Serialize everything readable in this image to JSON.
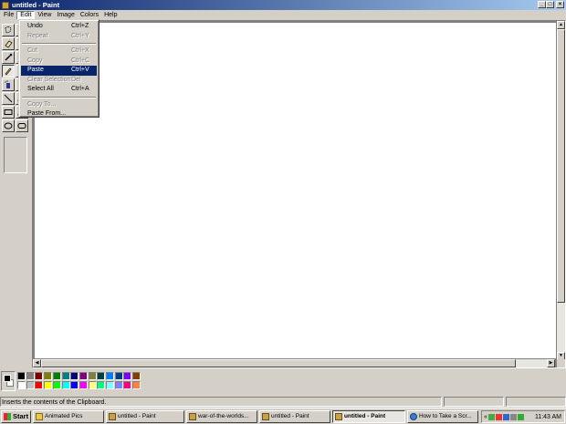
{
  "window": {
    "title": "untitled - Paint"
  },
  "menubar": {
    "items": [
      "File",
      "Edit",
      "View",
      "Image",
      "Colors",
      "Help"
    ],
    "active": "Edit"
  },
  "edit_menu": {
    "items": [
      {
        "label": "Undo",
        "shortcut": "Ctrl+Z",
        "enabled": true
      },
      {
        "label": "Repeat",
        "shortcut": "Ctrl+Y",
        "enabled": false
      },
      {
        "label": "Cut",
        "shortcut": "Ctrl+X",
        "enabled": false
      },
      {
        "label": "Copy",
        "shortcut": "Ctrl+C",
        "enabled": false
      },
      {
        "label": "Paste",
        "shortcut": "Ctrl+V",
        "enabled": true,
        "highlighted": true
      },
      {
        "label": "Clear Selection",
        "shortcut": "Del",
        "enabled": false
      },
      {
        "label": "Select All",
        "shortcut": "Ctrl+A",
        "enabled": true
      },
      {
        "label": "Copy To...",
        "shortcut": "",
        "enabled": false
      },
      {
        "label": "Paste From...",
        "shortcut": "",
        "enabled": true
      }
    ]
  },
  "tools": [
    "free-select-icon",
    "select-icon",
    "eraser-icon",
    "fill-icon",
    "eyedropper-icon",
    "magnifier-icon",
    "pencil-icon",
    "brush-icon",
    "airbrush-icon",
    "text-icon",
    "line-icon",
    "curve-icon",
    "rectangle-icon",
    "polygon-icon",
    "ellipse-icon",
    "rounded-rectangle-icon"
  ],
  "selected_tool": "pencil-icon",
  "palette": {
    "foreground": "#000000",
    "background": "#ffffff",
    "colors": [
      "#000000",
      "#808080",
      "#800000",
      "#808000",
      "#008000",
      "#008080",
      "#000080",
      "#800080",
      "#808040",
      "#004040",
      "#0080ff",
      "#004080",
      "#8000ff",
      "#804000",
      "#ffffff",
      "#c0c0c0",
      "#ff0000",
      "#ffff00",
      "#00ff00",
      "#00ffff",
      "#0000ff",
      "#ff00ff",
      "#ffff80",
      "#00ff80",
      "#80ffff",
      "#8080ff",
      "#ff0080",
      "#ff8040"
    ]
  },
  "status": {
    "text": "Inserts the contents of the Clipboard."
  },
  "taskbar": {
    "start_label": "Start",
    "buttons": [
      {
        "label": "Animated Pics",
        "icon": "folder-icon",
        "active": false
      },
      {
        "label": "untitled - Paint",
        "icon": "paint-icon",
        "active": false
      },
      {
        "label": "war-of-the-worlds...",
        "icon": "paint-icon",
        "active": false
      },
      {
        "label": "untitled - Paint",
        "icon": "paint-icon",
        "active": false
      },
      {
        "label": "untitled - Paint",
        "icon": "paint-icon",
        "active": true
      },
      {
        "label": "How to Take a Scr...",
        "icon": "browser-icon",
        "active": false
      }
    ],
    "tray_arrow": "«",
    "clock": "11:43 AM"
  }
}
